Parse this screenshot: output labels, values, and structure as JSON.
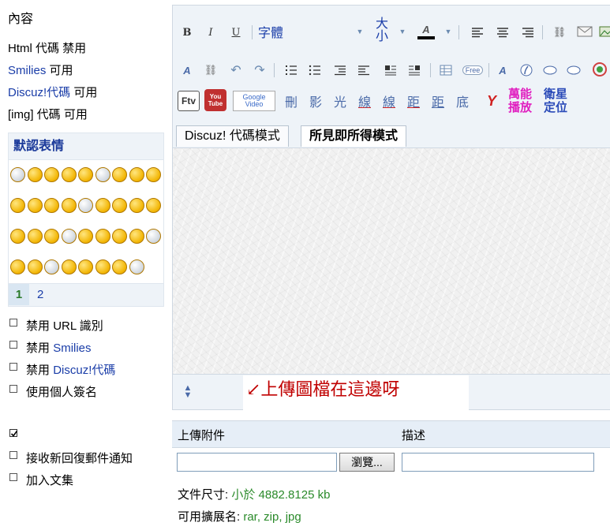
{
  "left": {
    "content_label": "內容",
    "html_code": {
      "label": "Html 代碼",
      "status": "禁用"
    },
    "smilies": {
      "label": "Smilies",
      "status": "可用"
    },
    "discuz": {
      "label": "Discuz!代碼",
      "status": "可用"
    },
    "img": {
      "label": "[img] 代碼",
      "status": "可用"
    },
    "smilies_panel": {
      "title": "默認表情",
      "pages": [
        "1",
        "2"
      ]
    },
    "options": [
      {
        "prefix": "禁用",
        "label": "URL 識別"
      },
      {
        "prefix": "禁用",
        "label": "Smilies"
      },
      {
        "prefix": "禁用",
        "label": "Discuz!代碼"
      },
      {
        "prefix": "",
        "label": "使用個人簽名"
      }
    ],
    "checked_box_label": "",
    "options2": [
      {
        "label": "接收新回復郵件通知"
      },
      {
        "label": "加入文集"
      }
    ]
  },
  "editor": {
    "toolbar": {
      "bold": "B",
      "italic": "I",
      "underline": "U",
      "font_label": "字體",
      "size_label": "大小",
      "color_label": "A",
      "special_chars": [
        "刪",
        "影",
        "光",
        "線",
        "線",
        "距",
        "距",
        "底"
      ],
      "media_labels": [
        "萬能",
        "播放",
        "衛星",
        "定位"
      ],
      "free_label": "Free",
      "google_video": "Google Video",
      "youtube": "You Tube",
      "ftv": "Ftv"
    },
    "tabs": [
      "Discuz! 代碼模式",
      "所見即所得模式"
    ],
    "annotation": "↙上傳圖檔在這邊呀"
  },
  "attachments": {
    "header_upload": "上傳附件",
    "header_desc": "描述",
    "browse_button": "瀏覽...",
    "size_label": "文件尺寸:",
    "size_value": "小於 4882.8125 kb",
    "ext_label": "可用擴展名:",
    "ext_value": "rar, zip, jpg"
  }
}
